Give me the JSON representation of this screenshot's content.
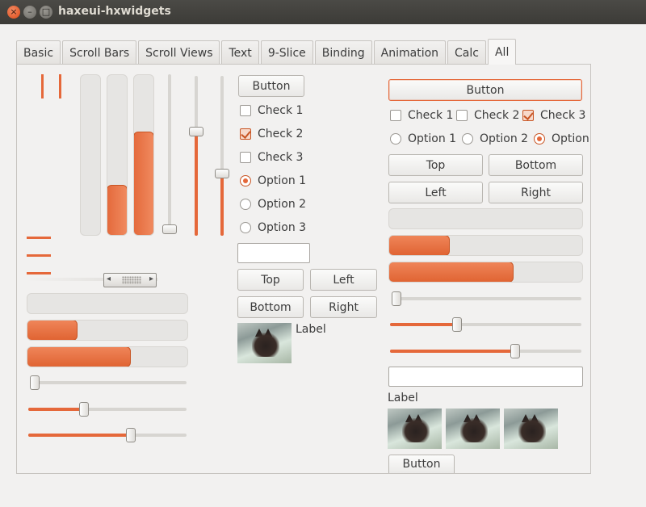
{
  "window": {
    "title": "haxeui-hxwidgets",
    "close_glyph": "×",
    "minimize_glyph": "–",
    "maximize_glyph": "□"
  },
  "tabs": [
    {
      "label": "Basic"
    },
    {
      "label": "Scroll Bars"
    },
    {
      "label": "Scroll Views"
    },
    {
      "label": "Text"
    },
    {
      "label": "9-Slice"
    },
    {
      "label": "Binding"
    },
    {
      "label": "Animation"
    },
    {
      "label": "Calc"
    },
    {
      "label": "All",
      "active": true
    }
  ],
  "left": {
    "vertical_progress": [
      0.0,
      0.32,
      0.65
    ],
    "vertical_sliders": [
      0.0,
      0.66,
      0.38
    ],
    "horizontal_progress": [
      0.0,
      0.32,
      0.65
    ],
    "horizontal_sliders": [
      0.0,
      0.34,
      0.66
    ],
    "scrollbar_position": 0.6
  },
  "middle": {
    "button_label": "Button",
    "checks": [
      {
        "label": "Check 1",
        "checked": false
      },
      {
        "label": "Check 2",
        "checked": true
      },
      {
        "label": "Check 3",
        "checked": false
      }
    ],
    "options": [
      {
        "label": "Option 1",
        "selected": true
      },
      {
        "label": "Option 2",
        "selected": false
      },
      {
        "label": "Option 3",
        "selected": false
      }
    ],
    "text_value": "",
    "grid_buttons": [
      "Top",
      "Left",
      "Bottom",
      "Right"
    ],
    "image_label": "Label",
    "image_icon": "cat-photo"
  },
  "right": {
    "button_label": "Button",
    "checks": [
      {
        "label": "Check 1",
        "checked": false
      },
      {
        "label": "Check 2",
        "checked": false
      },
      {
        "label": "Check 3",
        "checked": true
      }
    ],
    "options": [
      {
        "label": "Option 1",
        "selected": false
      },
      {
        "label": "Option 2",
        "selected": false
      },
      {
        "label": "Option",
        "selected": true
      }
    ],
    "grid_buttons": [
      "Top",
      "Bottom",
      "Left",
      "Right"
    ],
    "horizontal_progress": [
      0.0,
      0.32,
      0.65
    ],
    "horizontal_sliders": [
      0.0,
      0.34,
      0.66
    ],
    "text_value": "",
    "label": "Label",
    "bottom_button_label": "Button"
  },
  "colors": {
    "accent": "#e5683a",
    "background": "#f2f1f0",
    "titlebar": "#3c3b37"
  }
}
